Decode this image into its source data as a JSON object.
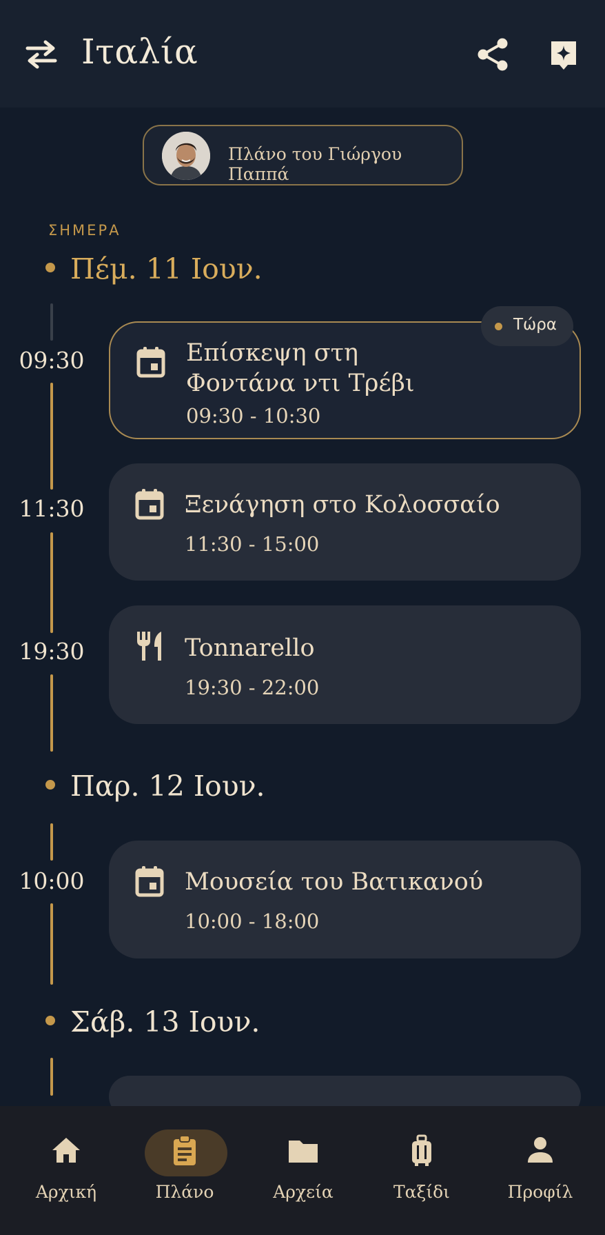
{
  "appbar": {
    "title": "Ιταλία",
    "icons": [
      "swap-icon",
      "share-icon",
      "sparkle-bookmark-icon"
    ]
  },
  "owner": {
    "label": "Πλάνο του Γιώργου Παππά"
  },
  "today_label": "ΣΗΜΕΡΑ",
  "now_badge": "Τώρα",
  "days": [
    {
      "date": "Πέμ. 11 Ιουν.",
      "events": [
        {
          "time": "09:30",
          "title_line1": "Επίσκεψη στη",
          "title_line2": "Φοντάνα ντι Τρέβι",
          "range": "09:30 - 10:30",
          "icon": "calendar-icon",
          "current": true
        },
        {
          "time": "11:30",
          "title": "Ξενάγηση στο Κολοσσαίο",
          "range": "11:30 - 15:00",
          "icon": "calendar-icon"
        },
        {
          "time": "19:30",
          "title": "Tonnarello",
          "range": "19:30 - 22:00",
          "icon": "restaurant-icon"
        }
      ]
    },
    {
      "date": "Παρ. 12 Ιουν.",
      "events": [
        {
          "time": "10:00",
          "title": "Μουσεία του Βατικανού",
          "range": "10:00 - 18:00",
          "icon": "calendar-icon"
        }
      ]
    },
    {
      "date": "Σάβ. 13 Ιουν.",
      "events": []
    }
  ],
  "nav": {
    "items": [
      {
        "label": "Αρχική",
        "icon": "home-icon"
      },
      {
        "label": "Πλάνο",
        "icon": "clipboard-icon",
        "active": true
      },
      {
        "label": "Αρχεία",
        "icon": "folder-icon"
      },
      {
        "label": "Ταξίδι",
        "icon": "luggage-icon"
      },
      {
        "label": "Προφίλ",
        "icon": "person-icon"
      }
    ]
  },
  "colors": {
    "background": "#121b29",
    "accent": "#c4984b",
    "card": "#272d39",
    "text": "#ecdcc2"
  }
}
